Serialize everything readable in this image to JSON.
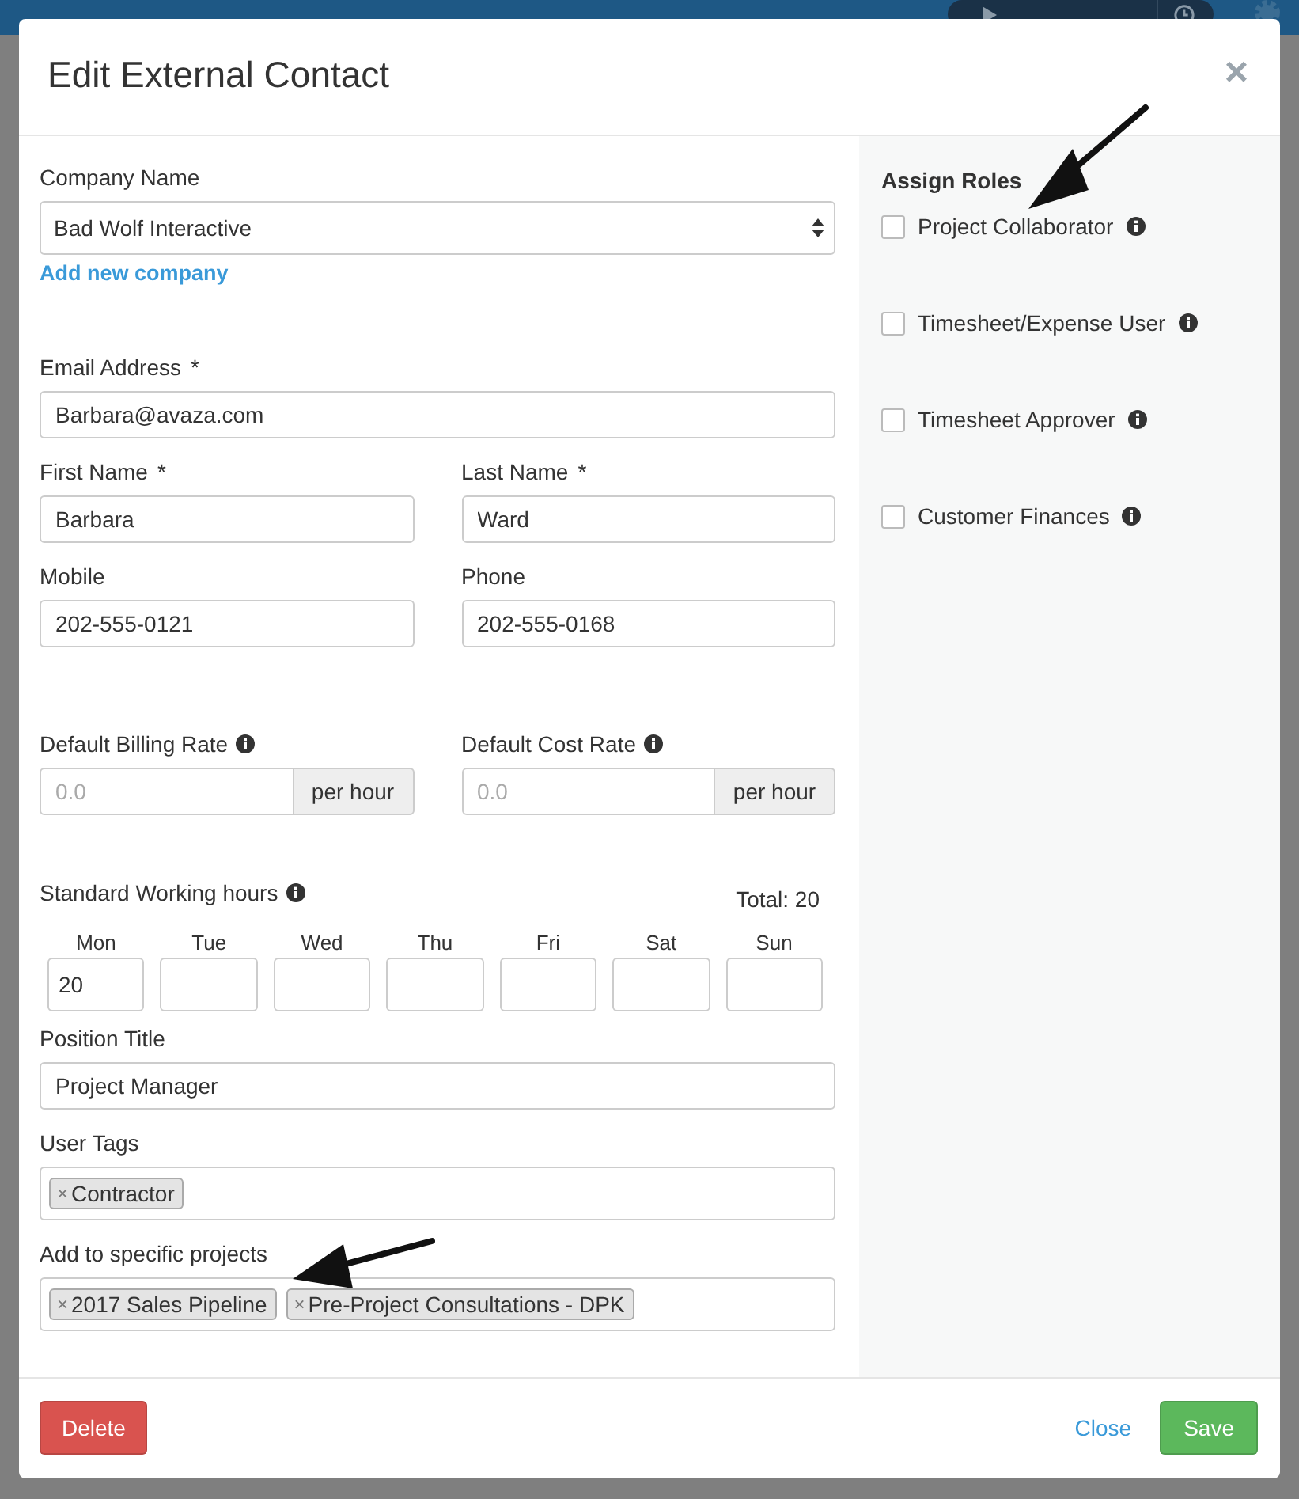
{
  "modal": {
    "title": "Edit External Contact",
    "close": "×"
  },
  "company": {
    "label": "Company Name",
    "value": "Bad Wolf Interactive",
    "link": "Add new company"
  },
  "email": {
    "label": "Email Address",
    "required_mark": "*",
    "value": "Barbara@avaza.com"
  },
  "name_row": [
    {
      "label": "First Name",
      "required_mark": "*",
      "value": "Barbara"
    },
    {
      "label": "Last Name",
      "required_mark": "*",
      "value": "Ward"
    }
  ],
  "contact_row": [
    {
      "label": "Mobile",
      "value": "202-555-0121"
    },
    {
      "label": "Phone",
      "value": "202-555-0168"
    }
  ],
  "rates": [
    {
      "label": "Default Billing Rate",
      "info": true,
      "placeholder": "0.0",
      "unit": "per hour"
    },
    {
      "label": "Default Cost Rate",
      "info": true,
      "placeholder": "0.0",
      "unit": "per hour"
    }
  ],
  "working_hours": {
    "label": "Standard Working hours",
    "info": true,
    "total": "Total: 20",
    "days": [
      {
        "day": "Mon",
        "value": "20"
      },
      {
        "day": "Tue"
      },
      {
        "day": "Wed"
      },
      {
        "day": "Thu"
      },
      {
        "day": "Fri"
      },
      {
        "day": "Sat"
      },
      {
        "day": "Sun"
      }
    ]
  },
  "position": {
    "label": "Position Title",
    "value": "Project Manager"
  },
  "user_tags": {
    "label": "User Tags",
    "tags": [
      {
        "remove": "×",
        "label": "Contractor"
      }
    ]
  },
  "projects": {
    "label": "Add to specific projects",
    "tags": [
      {
        "remove": "×",
        "label": "2017 Sales Pipeline"
      },
      {
        "remove": "×",
        "label": "Pre-Project Consultations - DPK"
      }
    ]
  },
  "roles": {
    "title": "Assign Roles",
    "items": [
      {
        "label": "Project Collaborator",
        "checked": false,
        "info": true
      },
      {
        "label": "Timesheet/Expense User",
        "checked": false,
        "info": true
      },
      {
        "label": "Timesheet Approver",
        "checked": false,
        "info": true
      },
      {
        "label": "Customer Finances",
        "checked": false,
        "info": true
      }
    ]
  },
  "footer": {
    "delete": "Delete",
    "close": "Close",
    "save": "Save"
  }
}
